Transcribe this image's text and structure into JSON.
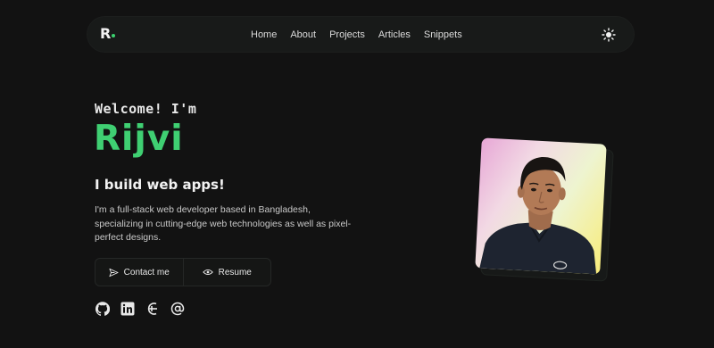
{
  "nav": {
    "logo": "R",
    "links": [
      "Home",
      "About",
      "Projects",
      "Articles",
      "Snippets"
    ],
    "theme_icon": "sun-icon"
  },
  "hero": {
    "welcome": "Welcome! I'm",
    "name": "Rijvi",
    "tagline": "I build web apps!",
    "description": "I'm a full-stack web developer based in Bangladesh, specializing in cutting-edge web technologies as well as pixel-perfect designs."
  },
  "buttons": {
    "contact": "Contact me",
    "resume": "Resume"
  },
  "socials": [
    "github-icon",
    "linkedin-icon",
    "hashnode-icon",
    "email-icon"
  ],
  "colors": {
    "accent": "#3fcf72",
    "background": "#121212"
  }
}
